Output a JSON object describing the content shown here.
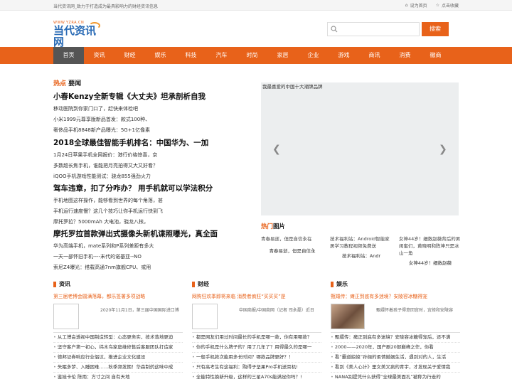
{
  "topbar": {
    "slogan": "当代资讯网_致力于打造成为最具影响力的财经资讯信息",
    "home": "设为首页",
    "fav": "点击收藏"
  },
  "logo": {
    "url": "WWW.YZRA.CN",
    "name": "当代资讯网"
  },
  "search": {
    "placeholder": "",
    "button": "搜索"
  },
  "nav": [
    "首页",
    "资讯",
    "财经",
    "娱乐",
    "科技",
    "汽车",
    "时尚",
    "家居",
    "企业",
    "游戏",
    "商讯",
    "消费",
    "徽商"
  ],
  "hot": {
    "accent": "热点",
    "rest": "要闻"
  },
  "news": [
    {
      "h": "小春Kenzy全新专辑《大丈夫》坦承剖析自我",
      "s": [
        "移动医院到你家门口了，赶快来体检吧",
        "小米1999元尊享版新品首发：款式100种、",
        "奢侈品手机8848新产品曝光：5G+1亿像素"
      ]
    },
    {
      "h": "2018全球最佳智能手机排名：中国华为、一加",
      "s": [
        "1月24日苹果手机全网报价：港行价格惊喜，京",
        "多数超长焦手机，谁能把月亮拍得又大又好看？",
        "iQOO手机游戏性能测试：骁龙855强劲火力"
      ]
    },
    {
      "h": "驾车违章，扣了分咋办？ 用手机就可以学法积分",
      "s": [
        "手机地图这样操作，能够看到世界的每个角落，甚",
        "手机运行速度慢？这几个技巧让你手机运行快到飞",
        "摩托罗拉？5000mAh 大电池，骁龙八核，"
      ]
    },
    {
      "h": "摩托罗拉首款弹出式摄像头新机谍照曝光，真全面",
      "s": [
        "华为高端手机，mate系列和P系列差距有多大",
        "一天一部怀旧手机----末代的诺基亚--NO",
        "索尼Z4曝光：搭载高通7nm旗舰CPU、或用"
      ]
    }
  ],
  "slider": {
    "caption": "我最喜爱的中国十大潮牌品牌"
  },
  "pics": {
    "accent": "热门",
    "rest": "图片",
    "items": [
      {
        "alt": "青春易逝，但是自信永在",
        "cap": "青春易逝，但是自信永"
      },
      {
        "alt": "技术福利站：Android智能家居学习教程视频免费送",
        "cap": "技术福利站：Andr"
      },
      {
        "alt": "女神44岁！细数赵薇背后的男闺蜜们，黄晓明和陈坤只是冰山一角",
        "cap": "女神44岁！细数赵薇"
      }
    ]
  },
  "cols": [
    {
      "title": "资讯",
      "lead": "第三届老博会圆满落幕，都乐签署多项战略",
      "info": "2020年11月1日，第三届中国国际进口博",
      "list": [
        "从工博会透视中国制造转型：心态更务实，技术落地更迫",
        "坚守客户第一初心，纬木鸟家庭维修售后客服团队打造家",
        "德邦证券响应行业倡议，推进企业文化建设",
        "失眠多梦、入睡困难……秋季频发期！华森制药这味中成",
        "鉴娃卡伦 陈雨：方寸之间 自有天地"
      ]
    },
    {
      "title": "财经",
      "lead": "网购狂欢季即将来临 消费者疯狂“买买买”是",
      "info": "中国商报/中国商网（记者 司永磊）近日",
      "list": [
        "都是网友们用过时间最长的手机是哪一款，你有用哪款？",
        "你的手机是什么牌子的？用了几年了？用得最久的是哪一",
        "一般手机款次能用多长时间？哪款品牌更好？！",
        "只有高考生有这福利：购得子坚果Pro手机送耳机!",
        "全能特性换新升级，这样的三星A70s能满足你吗？!"
      ]
    },
    {
      "title": "娱乐",
      "lead": "甄嬛传：瘫正到底有多迷境？安陵容冰糖得宠",
      "info": "甄嬛怀着孩子得意回宫时，宜修和安陵容",
      "list": [
        "甄嬛传：瘫正到底有多迷境？安陵容冰糖得宠后，还不满",
        "2000——2020年，国产剧20部巅峰之作，你看",
        "看“霸道娘娘”孙俪的柔情婚姻生活，遇到对的人，生活",
        "看到《美人心计》里文美又疯的青宇，才发现关于爱情我",
        "NANA别提凭什么获得“全球最美面孔”被称为行走的"
      ]
    }
  ]
}
